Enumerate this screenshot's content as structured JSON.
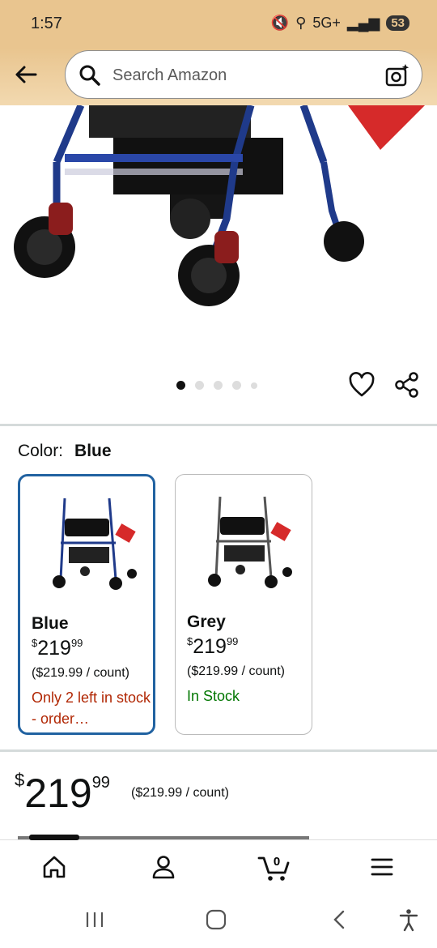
{
  "status": {
    "time": "1:57",
    "network": "5G+",
    "battery": "53"
  },
  "search": {
    "placeholder": "Search Amazon"
  },
  "gallery": {
    "image_count": 5,
    "active_index": 0
  },
  "color": {
    "label": "Color:",
    "selected": "Blue"
  },
  "options": [
    {
      "name": "Blue",
      "price_currency": "$",
      "price_dollars": "219",
      "price_cents": "99",
      "unit_price": "($219.99 / count)",
      "stock": "Only 2 left in stock - order…",
      "stock_color": "#b12704",
      "selected": true
    },
    {
      "name": "Grey",
      "price_currency": "$",
      "price_dollars": "219",
      "price_cents": "99",
      "unit_price": "($219.99 / count)",
      "stock": "In Stock",
      "stock_color": "#007600",
      "selected": false
    }
  ],
  "price": {
    "currency": "$",
    "dollars": "219",
    "cents": "99",
    "unit_price": "($219.99 / count)"
  },
  "nav": {
    "cart_count": "0",
    "items": [
      "home-icon",
      "account-icon",
      "cart-icon",
      "menu-icon"
    ]
  },
  "colors": {
    "header_bg": "#e9c58f",
    "accent_selected": "#2162a1",
    "stock_low": "#b12704",
    "stock_ok": "#007600"
  }
}
